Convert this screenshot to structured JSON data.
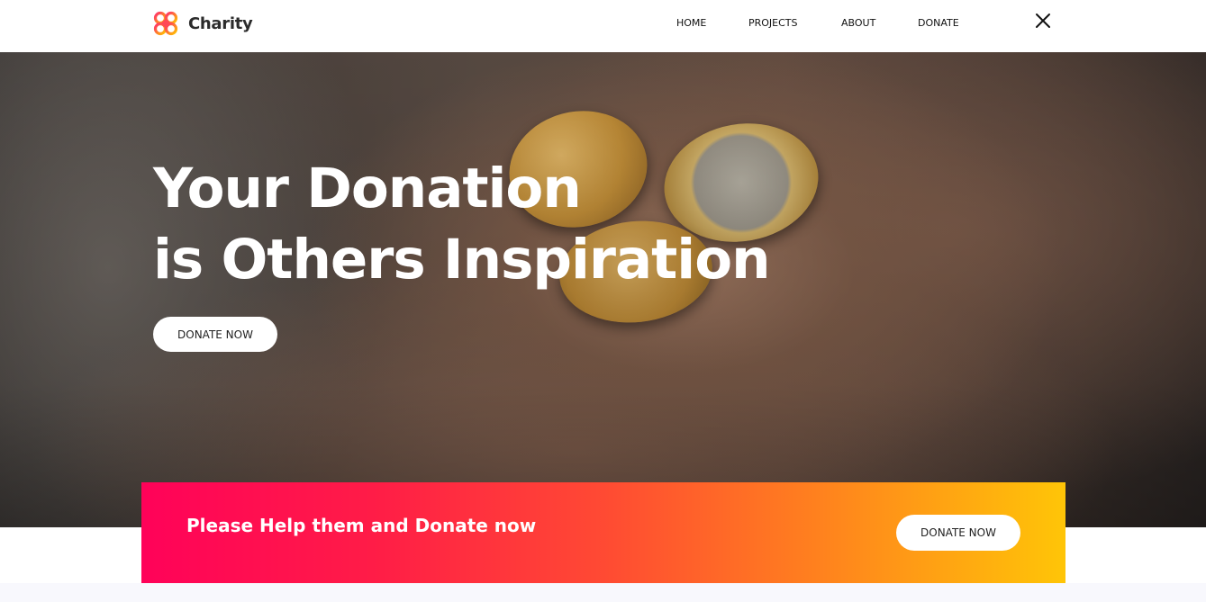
{
  "brand": {
    "name": "Charity",
    "logo_icon": "charity-logo-icon",
    "logo_colors": [
      "#ff2d6f",
      "#ff7a2f",
      "#ffc400"
    ]
  },
  "nav": {
    "items": [
      {
        "label": "HOME"
      },
      {
        "label": "PROJECTS"
      },
      {
        "label": "ABOUT"
      },
      {
        "label": "DONATE"
      }
    ],
    "close_icon": "close-icon"
  },
  "hero": {
    "title_line1": "Your Donation",
    "title_line2": "is Others Inspiration",
    "button_label": "DONATE NOW",
    "background": "photo of an open hand holding coins"
  },
  "cta": {
    "text": "Please Help them and Donate now",
    "button_label": "DONATE NOW",
    "gradient_colors": [
      "#ff0259",
      "#ff4a33",
      "#ffc507"
    ]
  }
}
